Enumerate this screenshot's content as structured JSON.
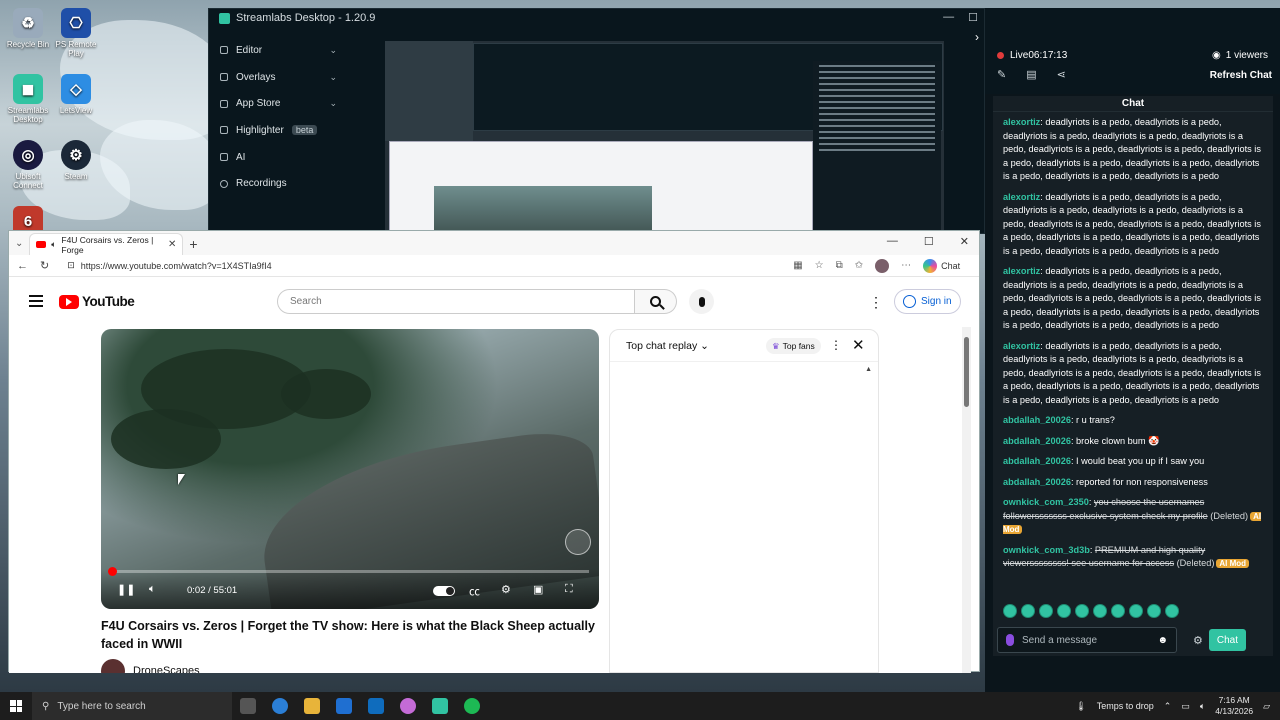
{
  "desktop": {
    "icons": [
      {
        "label": "Recycle Bin",
        "color": "#9ab"
      },
      {
        "label": "PS Remote Play",
        "color": "#1f4fa8"
      },
      {
        "label": "Streamlabs Desktop",
        "color": "#31c3a2"
      },
      {
        "label": "LetsView",
        "color": "#2d8de3"
      },
      {
        "label": "Ubisoft Connect",
        "color": "#1a1a40"
      },
      {
        "label": "Steam",
        "color": "#1b2838"
      },
      {
        "label": "6",
        "color": "#c0392b"
      }
    ]
  },
  "streamlabs": {
    "title": "Streamlabs Desktop - 1.20.9",
    "nav": [
      {
        "label": "Editor",
        "chevron": "⌄"
      },
      {
        "label": "Overlays",
        "chevron": "⌄"
      },
      {
        "label": "App Store",
        "chevron": "⌄"
      },
      {
        "label": "Highlighter",
        "badge": "beta"
      },
      {
        "label": "AI"
      },
      {
        "label": "Recordings"
      }
    ],
    "live_label": "Live",
    "live_time": "06:17:13",
    "viewers": "1 viewers",
    "refresh_chat": "Refresh Chat",
    "chat_title": "Chat",
    "send_placeholder": "Send a message",
    "send_button": "Chat",
    "messages": [
      {
        "user": "alexortiz",
        "text": "deadlyriots is a pedo, deadlyriots is a pedo, deadlyriots is a pedo, deadlyriots is a pedo, deadlyriots is a pedo, deadlyriots is a pedo, deadlyriots is a pedo, deadlyriots is a pedo, deadlyriots is a pedo, deadlyriots is a pedo, deadlyriots is a pedo, deadlyriots is a pedo, deadlyriots is a pedo",
        "deleted": false
      },
      {
        "user": "alexortiz",
        "text": "deadlyriots is a pedo, deadlyriots is a pedo, deadlyriots is a pedo, deadlyriots is a pedo, deadlyriots is a pedo, deadlyriots is a pedo, deadlyriots is a pedo, deadlyriots is a pedo, deadlyriots is a pedo, deadlyriots is a pedo, deadlyriots is a pedo, deadlyriots is a pedo, deadlyriots is a pedo",
        "deleted": false
      },
      {
        "user": "alexortiz",
        "text": "deadlyriots is a pedo, deadlyriots is a pedo, deadlyriots is a pedo, deadlyriots is a pedo, deadlyriots is a pedo, deadlyriots is a pedo, deadlyriots is a pedo, deadlyriots is a pedo, deadlyriots is a pedo, deadlyriots is a pedo, deadlyriots is a pedo, deadlyriots is a pedo, deadlyriots is a pedo",
        "deleted": false
      },
      {
        "user": "alexortiz",
        "text": "deadlyriots is a pedo, deadlyriots is a pedo, deadlyriots is a pedo, deadlyriots is a pedo, deadlyriots is a pedo, deadlyriots is a pedo, deadlyriots is a pedo, deadlyriots is a pedo, deadlyriots is a pedo, deadlyriots is a pedo, deadlyriots is a pedo, deadlyriots is a pedo, deadlyriots is a pedo",
        "deleted": false
      },
      {
        "user": "abdallah_20026",
        "text": "r u trans?",
        "deleted": false
      },
      {
        "user": "abdallah_20026",
        "text": "broke clown bum 🤡",
        "deleted": false
      },
      {
        "user": "abdallah_20026",
        "text": "I would beat you up if I saw you",
        "deleted": false
      },
      {
        "user": "abdallah_20026",
        "text": "reported for non responsiveness",
        "deleted": false
      },
      {
        "user": "ownkick_com_2350",
        "text": "you choose the usernames followersssssss exclusive system check my profile",
        "deleted": true,
        "deleted_label": "(Deleted)",
        "badge": "AI Mod"
      },
      {
        "user": "ownkick_com_3d3b",
        "text": "PREMIUM and high quality viewerssssssss! see username for access",
        "deleted": true,
        "deleted_label": "(Deleted)",
        "badge": "AI Mod"
      }
    ]
  },
  "browser": {
    "tab_title": "F4U Corsairs vs. Zeros | Forge",
    "url": "https://www.youtube.com/watch?v=1X4STIa9fI4",
    "chat_button": "Chat"
  },
  "youtube": {
    "logo_text": "YouTube",
    "search_placeholder": "Search",
    "sign_in": "Sign in",
    "time": "0:02 / 55:01",
    "progress": 0.001,
    "title": "F4U Corsairs vs. Zeros | Forget the TV show: Here is what the Black Sheep actually faced in WWII",
    "channel": "DroneScapes",
    "live_chat_mode": "Top chat replay",
    "top_fans": "Top fans"
  },
  "taskbar": {
    "search_placeholder": "Type here to search",
    "weather": "Temps to drop",
    "time": "7:16 AM",
    "date": "4/13/2026"
  }
}
